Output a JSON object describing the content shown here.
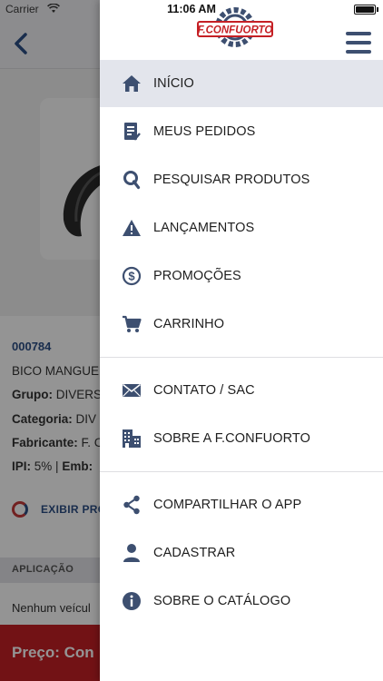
{
  "status_bar": {
    "carrier": "Carrier",
    "time": "11:06 AM"
  },
  "background": {
    "product_code": "000784",
    "product_name": "BICO MANGUE",
    "grupo_label": "Grupo:",
    "grupo_value": "DIVERS",
    "categoria_label": "Categoria:",
    "categoria_value": "DIV",
    "fabricante_label": "Fabricante:",
    "fabricante_value": "F. C",
    "ipi_label": "IPI:",
    "ipi_value": "5% |",
    "emb_label": "Emb:",
    "exibir_label": "EXIBIR PRO",
    "aplicacao_label": "APLICAÇÃO",
    "nenhum_text": "Nenhum veícul",
    "price_label": "Preço: Con"
  },
  "drawer": {
    "logo_text": "F.CONFUORTO",
    "brand_colors": {
      "primary": "#3d4f70",
      "red": "#c52025"
    },
    "menu": [
      {
        "id": "inicio",
        "label": "INÍCIO",
        "icon": "home-icon",
        "active": true
      },
      {
        "id": "meus-pedidos",
        "label": "MEUS PEDIDOS",
        "icon": "orders-icon",
        "active": false
      },
      {
        "id": "pesquisar",
        "label": "PESQUISAR PRODUTOS",
        "icon": "search-icon",
        "active": false
      },
      {
        "id": "lancamentos",
        "label": "LANÇAMENTOS",
        "icon": "warning-icon",
        "active": false
      },
      {
        "id": "promocoes",
        "label": "PROMOÇÕES",
        "icon": "dollar-icon",
        "active": false
      },
      {
        "id": "carrinho",
        "label": "CARRINHO",
        "icon": "cart-icon",
        "active": false
      },
      {
        "id": "contato",
        "label": "CONTATO / SAC",
        "icon": "envelope-icon",
        "active": false
      },
      {
        "id": "sobre",
        "label": "SOBRE A F.CONFUORTO",
        "icon": "building-icon",
        "active": false
      },
      {
        "id": "compartilhar",
        "label": "COMPARTILHAR O APP",
        "icon": "share-icon",
        "active": false
      },
      {
        "id": "cadastrar",
        "label": "CADASTRAR",
        "icon": "user-icon",
        "active": false
      },
      {
        "id": "sobre-catalogo",
        "label": "SOBRE O CATÁLOGO",
        "icon": "info-icon",
        "active": false
      }
    ]
  }
}
